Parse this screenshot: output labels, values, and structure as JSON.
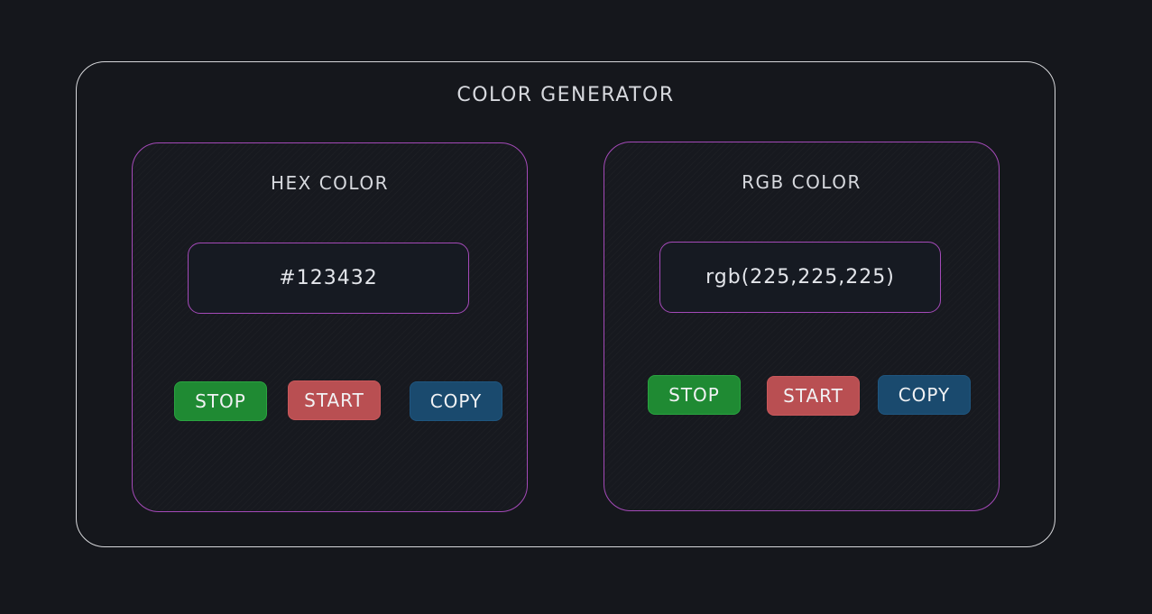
{
  "app": {
    "title": "COLOR GENERATOR"
  },
  "hex_card": {
    "title": "HEX COLOR",
    "value": "#123432",
    "stop_label": "STOP",
    "start_label": "START",
    "copy_label": "COPY"
  },
  "rgb_card": {
    "title": "RGB COLOR",
    "value": "rgb(225,225,225)",
    "stop_label": "STOP",
    "start_label": "START",
    "copy_label": "COPY"
  },
  "colors": {
    "background": "#15171c",
    "outer_border": "#d6d7da",
    "card_border": "#a44ab8",
    "stop_button": "#1f8a33",
    "start_button": "#b94f52",
    "copy_button": "#1a4a6e"
  }
}
